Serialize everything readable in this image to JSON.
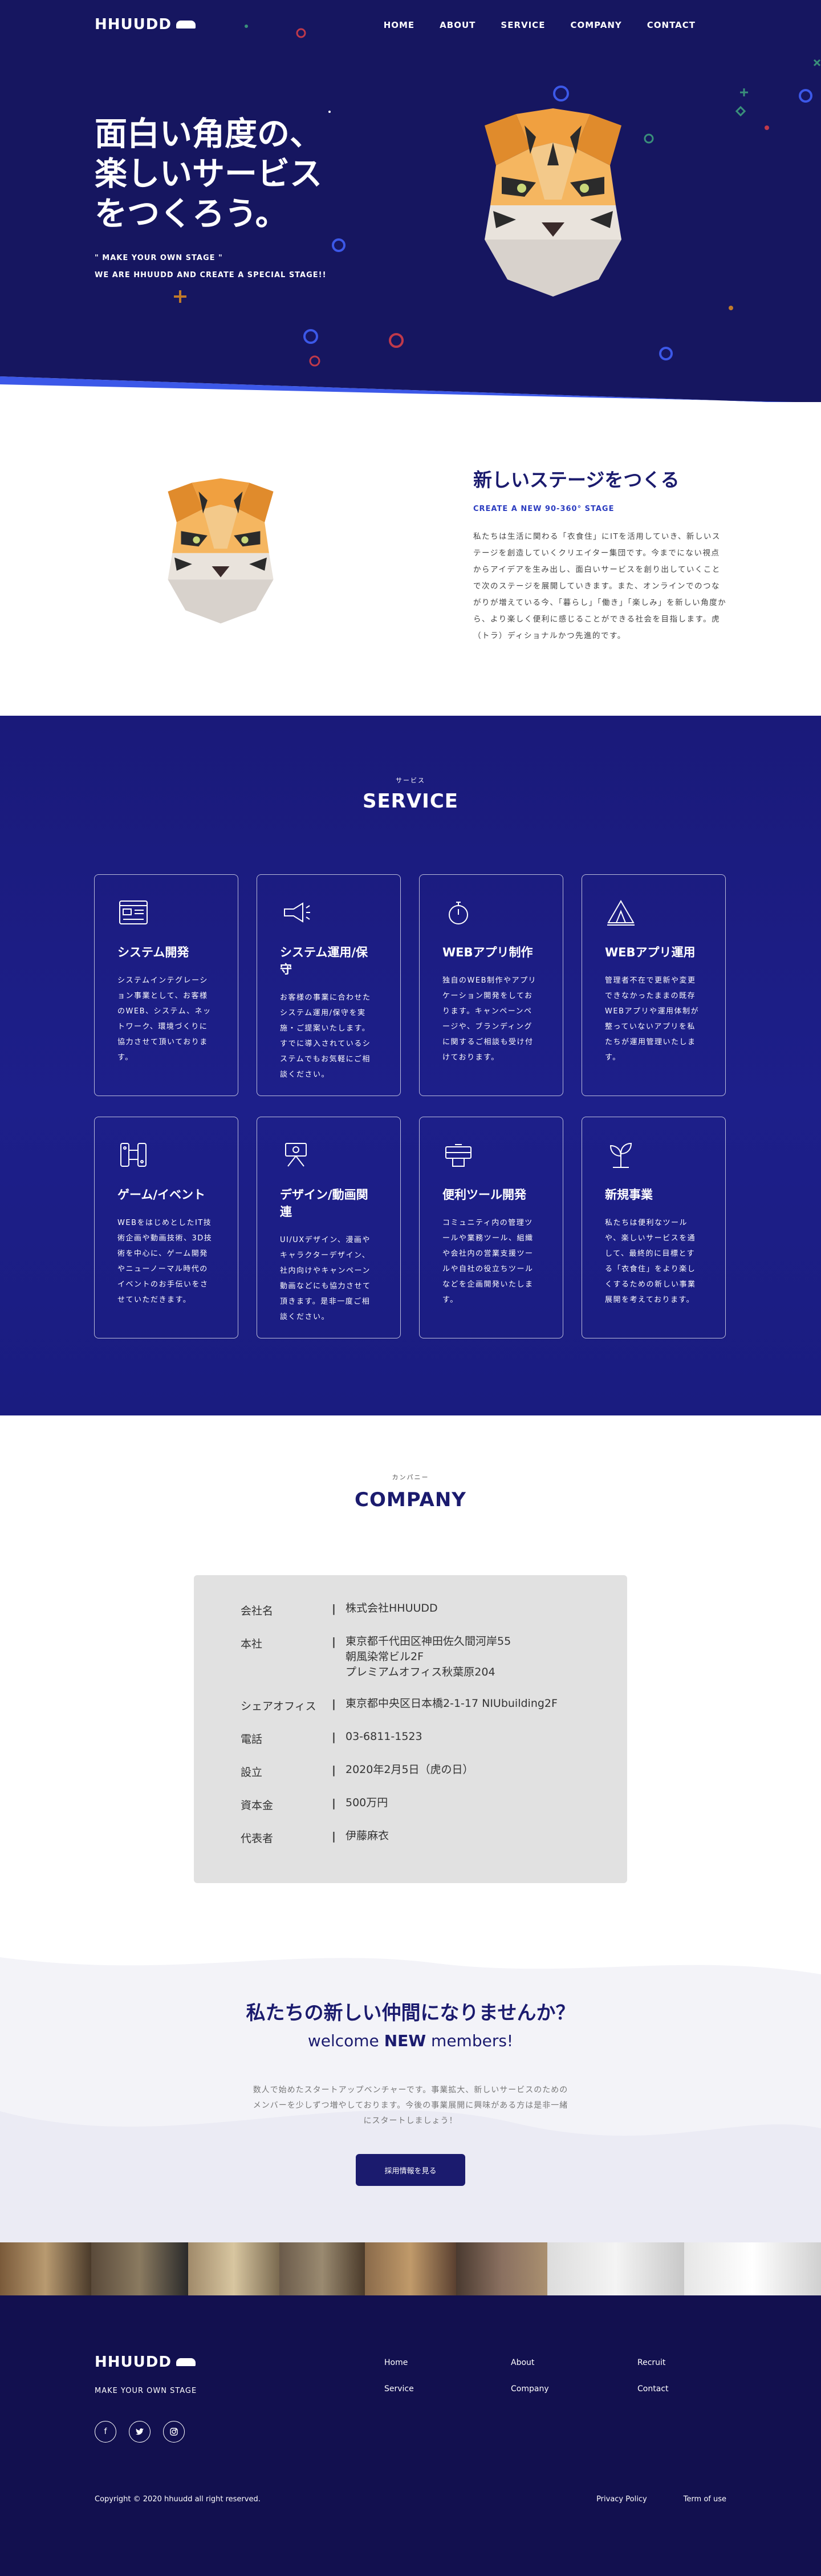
{
  "nav": {
    "logo": "HHUUDD",
    "links": [
      "HOME",
      "ABOUT",
      "SERVICE",
      "COMPANY",
      "CONTACT"
    ]
  },
  "hero": {
    "title_lines": [
      "面白い角度の、",
      "楽しいサービス",
      "をつくろう。"
    ],
    "tagline1": "\" MAKE YOUR OWN STAGE \"",
    "tagline2": "WE ARE HHUUDD AND CREATE A SPECIAL STAGE!!"
  },
  "about": {
    "title": "新しいステージをつくる",
    "subtitle": "CREATE A NEW 90-360° STAGE",
    "text": "私たちは生活に関わる「衣食住」にITを活用していき、新しいステージを創造していくクリエイター集団です。今までにない視点からアイデアを生み出し、面白いサービスを創り出していくことで次のステージを展開していきます。また、オンラインでのつながりが増えている今、「暮らし」「働き」「楽しみ」を新しい角度から、より楽しく便利に感じることができる社会を目指します。虎（トラ）ディショナルかつ先進的です。"
  },
  "service": {
    "kana": "サービス",
    "title": "SERVICE",
    "cards": [
      {
        "icon": "dashboard-icon",
        "title": "システム開発",
        "text": "システムインテグレーション事業として、お客様のWEB、システム、ネットワーク、環境づくりに協力させて頂いております。"
      },
      {
        "icon": "megaphone-icon",
        "title": "システム運用/保守",
        "text": "お客様の事業に合わせたシステム運用/保守を実施・ご提案いたします。すでに導入されているシステムでもお気軽にご相談ください。"
      },
      {
        "icon": "stopwatch-icon",
        "title": "WEBアプリ制作",
        "text": "独自のWEB制作やアプリケーション開発をしております。キャンペーンページや、ブランディングに関するご相談も受け付けております。"
      },
      {
        "icon": "camp-icon",
        "title": "WEBアプリ運用",
        "text": "管理者不在で更新や変更できなかったままの既存WEBアプリや運用体制が整っていないアプリを私たちが運用管理いたします。"
      },
      {
        "icon": "gamepad-icon",
        "title": "ゲーム/イベント",
        "text": "WEBをはじめとしたIT技術企画や動画技術、3D技術を中心に、ゲーム開発やニューノーマル時代のイベントのお手伝いをさせていただきます。"
      },
      {
        "icon": "designer-icon",
        "title": "デザイン/動画関連",
        "text": "UI/UXデザイン、漫画やキャラクターデザイン、社内向けやキャンペーン動画などにも協力させて頂きます。是非一度ご相談ください。"
      },
      {
        "icon": "toolbox-icon",
        "title": "便利ツール開発",
        "text": "コミュニティ内の管理ツールや業務ツール、組織や会社内の営業支援ツールや自社の役立ちツールなどを企画開発いたします。"
      },
      {
        "icon": "sprout-icon",
        "title": "新規事業",
        "text": "私たちは便利なツールや、楽しいサービスを通して、最終的に目標とする「衣食住」をより楽しくするための新しい事業展開を考えております。"
      }
    ]
  },
  "company": {
    "kana": "カンパニー",
    "title": "COMPANY",
    "rows": [
      {
        "label": "会社名",
        "sep": "|",
        "value": [
          "株式会社HHUUDD"
        ]
      },
      {
        "label": "本社",
        "sep": "|",
        "value": [
          "東京都千代田区神田佐久間河岸55",
          "朝風染常ビル2F",
          "プレミアムオフィス秋葉原204"
        ]
      },
      {
        "label": "シェアオフィス",
        "sep": "|",
        "value": [
          "東京都中央区日本橋2-1-17 NIUbuilding2F"
        ]
      },
      {
        "label": "電話",
        "sep": "|",
        "value": [
          "03-6811-1523"
        ]
      },
      {
        "label": "設立",
        "sep": "|",
        "value": [
          "2020年2月5日（虎の日）"
        ]
      },
      {
        "label": "資本金",
        "sep": "|",
        "value": [
          "500万円"
        ]
      },
      {
        "label": "代表者",
        "sep": "|",
        "value": [
          "伊藤麻衣"
        ]
      }
    ]
  },
  "recruit": {
    "title": "私たちの新しい仲間になりませんか？",
    "sub_pre": "welcome ",
    "sub_bold": "NEW",
    "sub_post": " members!",
    "text": "数人で始めたスタートアップベンチャーです。事業拡大、新しいサービスのためのメンバーを少しずつ増やしております。今後の事業展開に興味がある方は是非一緒にスタートしましょう！",
    "button": "採用情報を見る"
  },
  "footer": {
    "logo": "HHUUDD",
    "tagline": "MAKE YOUR OWN STAGE",
    "links": [
      "Home",
      "About",
      "Recruit",
      "Service",
      "Company",
      "Contact"
    ],
    "social": [
      "facebook-icon",
      "twitter-icon",
      "instagram-icon"
    ],
    "copyright": "Copyright © 2020 hhuudd all right reserved.",
    "policy": [
      "Privacy Policy",
      "Term of use"
    ]
  },
  "colors": {
    "navy": "#161660",
    "service_bg": "#1d1f8a",
    "accent_blue": "#2b3cc0",
    "footer_bg": "#12104f",
    "company_box": "#e1e1e1"
  }
}
